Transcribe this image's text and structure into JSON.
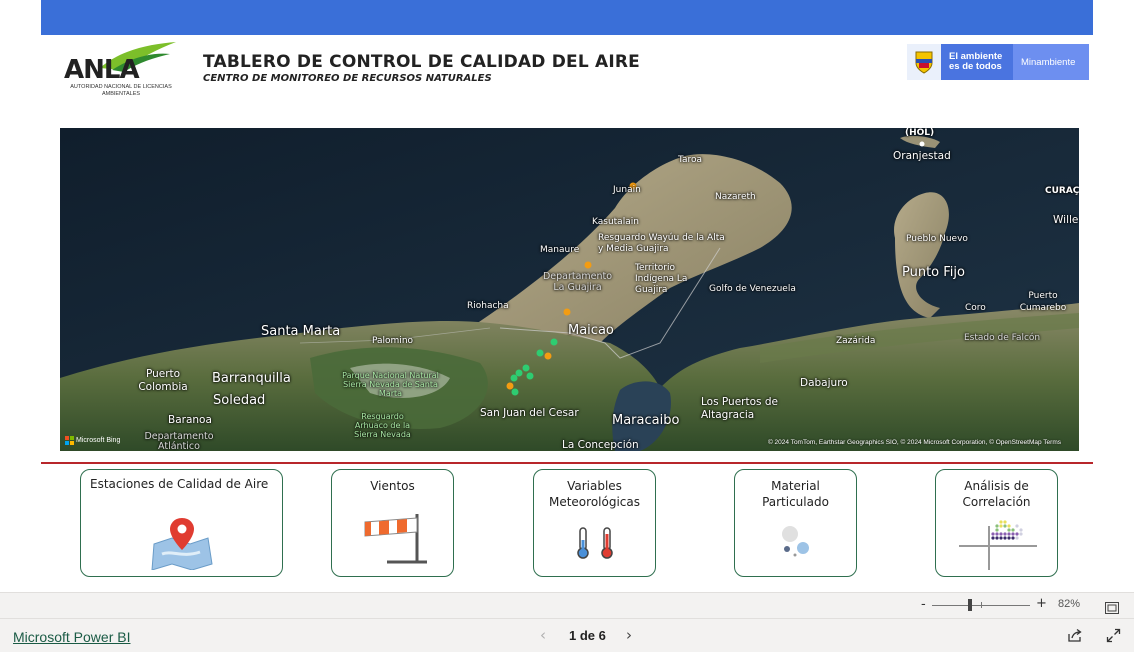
{
  "header": {
    "title": "TABLERO DE CONTROL DE CALIDAD DEL AIRE",
    "subtitle": "CENTRO DE MONITOREO DE RECURSOS NATURALES",
    "anla_logo": {
      "text": "ANLA",
      "subtext": "AUTORIDAD NACIONAL DE LICENCIAS AMBIENTALES"
    },
    "ministry_logo": {
      "slogan": "El ambiente es de todos",
      "name": "Minambiente"
    }
  },
  "colors": {
    "top_band": "#3a6fd8",
    "divider": "#b8262b",
    "card_border": "#2f6f4f",
    "station_green": "#2ecc71",
    "station_orange": "#f39c12"
  },
  "map": {
    "labels": {
      "hol": "(HOL)",
      "oranjestad": "Oranjestad",
      "curacao": "CURAÇ",
      "wille": "Wille",
      "taroa": "Taroa",
      "junain": "Junain",
      "nazareth": "Nazareth",
      "kasutalain": "Kasutalain",
      "manaure": "Manaure",
      "resguardo_wayuu": "Resguardo Wayúu de la Alta y Media Guajira",
      "territorio_indigena": "Territorio Indígena La Guajira",
      "departamento_guajira": "Departamento La Guajira",
      "golfo": "Golfo de Venezuela",
      "pueblo_nuevo": "Pueblo Nuevo",
      "punto_fijo": "Punto Fijo",
      "puerto_cumarebo": "Puerto Cumarebo",
      "coro": "Coro",
      "estado_falcon": "Estado de Falcón",
      "riohacha": "Riohacha",
      "maicao": "Maicao",
      "santa_marta": "Santa Marta",
      "palomino": "Palomino",
      "zazarida": "Zazárida",
      "puerto_colombia": "Puerto Colombia",
      "barranquilla": "Barranquilla",
      "soledad": "Soledad",
      "parque_nacional": "Parque Nacional Natural Sierra Nevada de Santa Marta",
      "dabajuro": "Dabajuro",
      "baranoa": "Baranoa",
      "departamento_atlantico": "Departamento Atlántico",
      "resguardo_arhuaco": "Resguardo Arhuaco de la Sierra Nevada",
      "san_juan": "San Juan del Cesar",
      "maracaibo": "Maracaibo",
      "los_puertos": "Los Puertos de Altagracia",
      "la_concepcion": "La Concepción"
    },
    "provider": "Microsoft Bing",
    "copyright": "© 2024 TomTom, Earthstar Geographics SIO, © 2024 Microsoft Corporation, © OpenStreetMap Terms"
  },
  "cards": [
    {
      "label": "Estaciones de Calidad de Aire",
      "icon": "map-pin-icon"
    },
    {
      "label": "Vientos",
      "icon": "windsock-icon"
    },
    {
      "label": "Variables Meteorológicas",
      "icon": "thermometer-icon"
    },
    {
      "label": "Material Particulado",
      "icon": "particles-icon"
    },
    {
      "label": "Análisis de Correlación",
      "icon": "scatter-icon"
    }
  ],
  "zoom": {
    "minus": "-",
    "plus": "+",
    "level": "82%",
    "level_fraction": 0.82
  },
  "footer": {
    "powerbi_link": "Microsoft Power BI",
    "page_indicator": "1 de 6",
    "prev": "‹",
    "next": "›"
  }
}
